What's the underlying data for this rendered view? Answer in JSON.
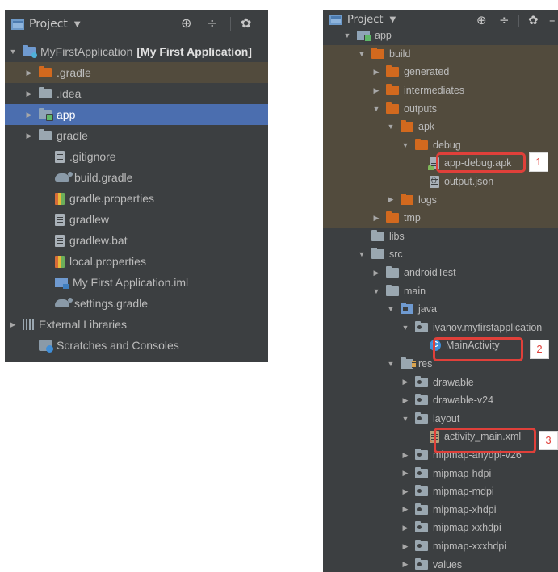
{
  "left": {
    "title": "Project",
    "items": [
      {
        "label": "MyFirstApplication",
        "extra": "[My First Application]",
        "depth": 0,
        "arrow": "open",
        "icon": "project-folder-icon",
        "state": ""
      },
      {
        "label": ".gradle",
        "depth": 1,
        "arrow": "closed",
        "icon": "folder-orange-icon",
        "state": "excluded"
      },
      {
        "label": ".idea",
        "depth": 1,
        "arrow": "closed",
        "icon": "folder-icon",
        "state": ""
      },
      {
        "label": "app",
        "depth": 1,
        "arrow": "closed",
        "icon": "module-folder-icon",
        "state": "selected"
      },
      {
        "label": "gradle",
        "depth": 1,
        "arrow": "closed",
        "icon": "folder-icon",
        "state": ""
      },
      {
        "label": ".gitignore",
        "depth": 2,
        "arrow": "none",
        "icon": "text-file-icon",
        "state": ""
      },
      {
        "label": "build.gradle",
        "depth": 2,
        "arrow": "none",
        "icon": "gradle-icon",
        "state": ""
      },
      {
        "label": "gradle.properties",
        "depth": 2,
        "arrow": "none",
        "icon": "properties-file-icon",
        "state": ""
      },
      {
        "label": "gradlew",
        "depth": 2,
        "arrow": "none",
        "icon": "text-file-icon",
        "state": ""
      },
      {
        "label": "gradlew.bat",
        "depth": 2,
        "arrow": "none",
        "icon": "text-file-icon",
        "state": ""
      },
      {
        "label": "local.properties",
        "depth": 2,
        "arrow": "none",
        "icon": "properties-file-icon",
        "state": ""
      },
      {
        "label": "My First Application.iml",
        "depth": 2,
        "arrow": "none",
        "icon": "iml-file-icon",
        "state": ""
      },
      {
        "label": "settings.gradle",
        "depth": 2,
        "arrow": "none",
        "icon": "gradle-icon",
        "state": ""
      },
      {
        "label": "External Libraries",
        "depth": 0,
        "arrow": "closed",
        "icon": "libraries-icon",
        "state": ""
      },
      {
        "label": "Scratches and Consoles",
        "depth": 1,
        "arrow": "none",
        "icon": "scratches-icon",
        "state": ""
      }
    ]
  },
  "right": {
    "title": "Project",
    "items": [
      {
        "label": "app",
        "depth": 1,
        "arrow": "open",
        "icon": "module-folder-icon",
        "state": ""
      },
      {
        "label": "build",
        "depth": 2,
        "arrow": "open",
        "icon": "folder-orange-icon",
        "state": "excluded"
      },
      {
        "label": "generated",
        "depth": 3,
        "arrow": "closed",
        "icon": "folder-orange-icon",
        "state": "excluded"
      },
      {
        "label": "intermediates",
        "depth": 3,
        "arrow": "closed",
        "icon": "folder-orange-icon",
        "state": "excluded"
      },
      {
        "label": "outputs",
        "depth": 3,
        "arrow": "open",
        "icon": "folder-orange-icon",
        "state": "excluded"
      },
      {
        "label": "apk",
        "depth": 4,
        "arrow": "open",
        "icon": "folder-orange-icon",
        "state": "excluded"
      },
      {
        "label": "debug",
        "depth": 5,
        "arrow": "open",
        "icon": "folder-orange-icon",
        "state": "excluded"
      },
      {
        "label": "app-debug.apk",
        "depth": 6,
        "arrow": "none",
        "icon": "apk-file-icon",
        "state": "excluded"
      },
      {
        "label": "output.json",
        "depth": 6,
        "arrow": "none",
        "icon": "json-file-icon",
        "state": "excluded"
      },
      {
        "label": "logs",
        "depth": 4,
        "arrow": "closed",
        "icon": "folder-orange-icon",
        "state": "excluded"
      },
      {
        "label": "tmp",
        "depth": 3,
        "arrow": "closed",
        "icon": "folder-orange-icon",
        "state": "excluded"
      },
      {
        "label": "libs",
        "depth": 2,
        "arrow": "none",
        "icon": "folder-icon",
        "state": ""
      },
      {
        "label": "src",
        "depth": 2,
        "arrow": "open",
        "icon": "folder-icon",
        "state": ""
      },
      {
        "label": "androidTest",
        "depth": 3,
        "arrow": "closed",
        "icon": "folder-icon",
        "state": ""
      },
      {
        "label": "main",
        "depth": 3,
        "arrow": "open",
        "icon": "folder-icon",
        "state": ""
      },
      {
        "label": "java",
        "depth": 4,
        "arrow": "open",
        "icon": "source-folder-icon",
        "state": ""
      },
      {
        "label": "ivanov.myfirstapplication",
        "depth": 5,
        "arrow": "open",
        "icon": "package-icon",
        "state": ""
      },
      {
        "label": "MainActivity",
        "depth": 6,
        "arrow": "none",
        "icon": "class-icon",
        "state": ""
      },
      {
        "label": "res",
        "depth": 4,
        "arrow": "open",
        "icon": "resources-folder-icon",
        "state": ""
      },
      {
        "label": "drawable",
        "depth": 5,
        "arrow": "closed",
        "icon": "package-icon",
        "state": ""
      },
      {
        "label": "drawable-v24",
        "depth": 5,
        "arrow": "closed",
        "icon": "package-icon",
        "state": ""
      },
      {
        "label": "layout",
        "depth": 5,
        "arrow": "open",
        "icon": "package-icon",
        "state": ""
      },
      {
        "label": "activity_main.xml",
        "depth": 6,
        "arrow": "none",
        "icon": "xml-file-icon",
        "state": ""
      },
      {
        "label": "mipmap-anydpi-v26",
        "depth": 5,
        "arrow": "closed",
        "icon": "package-icon",
        "state": ""
      },
      {
        "label": "mipmap-hdpi",
        "depth": 5,
        "arrow": "closed",
        "icon": "package-icon",
        "state": ""
      },
      {
        "label": "mipmap-mdpi",
        "depth": 5,
        "arrow": "closed",
        "icon": "package-icon",
        "state": ""
      },
      {
        "label": "mipmap-xhdpi",
        "depth": 5,
        "arrow": "closed",
        "icon": "package-icon",
        "state": ""
      },
      {
        "label": "mipmap-xxhdpi",
        "depth": 5,
        "arrow": "closed",
        "icon": "package-icon",
        "state": ""
      },
      {
        "label": "mipmap-xxxhdpi",
        "depth": 5,
        "arrow": "closed",
        "icon": "package-icon",
        "state": ""
      },
      {
        "label": "values",
        "depth": 5,
        "arrow": "closed",
        "icon": "package-icon",
        "state": ""
      }
    ]
  },
  "callouts": [
    {
      "number": "1",
      "target": "app-debug.apk"
    },
    {
      "number": "2",
      "target": "MainActivity"
    },
    {
      "number": "3",
      "target": "activity_main.xml"
    }
  ],
  "colors": {
    "panel_bg": "#3c3f41",
    "excluded_bg": "#524b3d",
    "selection_bg": "#4b6eaf",
    "callout_red": "#e0403a"
  }
}
